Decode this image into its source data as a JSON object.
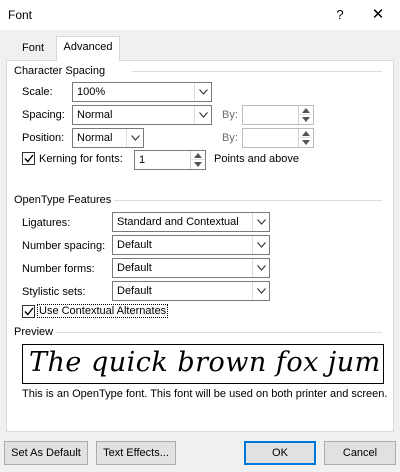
{
  "window": {
    "title": "Font",
    "help_glyph": "?",
    "close_glyph": "✕"
  },
  "tabs": [
    {
      "label": "Font",
      "active": false
    },
    {
      "label": "Advanced",
      "active": true
    }
  ],
  "character_spacing": {
    "heading": "Character Spacing",
    "scale_label": "Scale:",
    "scale_value": "100%",
    "spacing_label": "Spacing:",
    "spacing_value": "Normal",
    "spacing_by_label": "By:",
    "spacing_by_value": "",
    "position_label": "Position:",
    "position_value": "Normal",
    "position_by_label": "By:",
    "position_by_value": "",
    "kerning_label": "Kerning for fonts:",
    "kerning_checked": true,
    "kerning_value": "1",
    "kerning_suffix": "Points and above"
  },
  "opentype": {
    "heading": "OpenType Features",
    "ligatures_label": "Ligatures:",
    "ligatures_value": "Standard and Contextual",
    "number_spacing_label": "Number spacing:",
    "number_spacing_value": "Default",
    "number_forms_label": "Number forms:",
    "number_forms_value": "Default",
    "stylistic_sets_label": "Stylistic sets:",
    "stylistic_sets_value": "Default",
    "contextual_label": "Use Contextual Alternates",
    "contextual_checked": true
  },
  "preview": {
    "heading": "Preview",
    "sample_text": "The quick brown fox jum",
    "note": "This is an OpenType font. This font will be used on both printer and screen."
  },
  "buttons": {
    "set_default": "Set As Default",
    "text_effects": "Text Effects...",
    "ok": "OK",
    "cancel": "Cancel"
  }
}
